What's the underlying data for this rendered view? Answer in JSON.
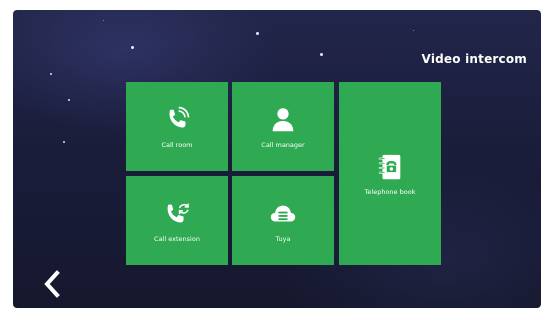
{
  "header": {
    "title": "Video intercom"
  },
  "tiles": [
    {
      "label": "Call room",
      "icon": "phone-ringing-icon"
    },
    {
      "label": "Call manager",
      "icon": "person-icon"
    },
    {
      "label": "Telephone book",
      "icon": "phone-book-icon"
    },
    {
      "label": "Call extension",
      "icon": "phone-transfer-icon"
    },
    {
      "label": "Tuya",
      "icon": "cloud-icon"
    }
  ],
  "navigation": {
    "back_icon": "chevron-left-icon"
  },
  "colors": {
    "tile": "#2faa52",
    "background": "#1b1e3c",
    "text": "#ffffff"
  }
}
